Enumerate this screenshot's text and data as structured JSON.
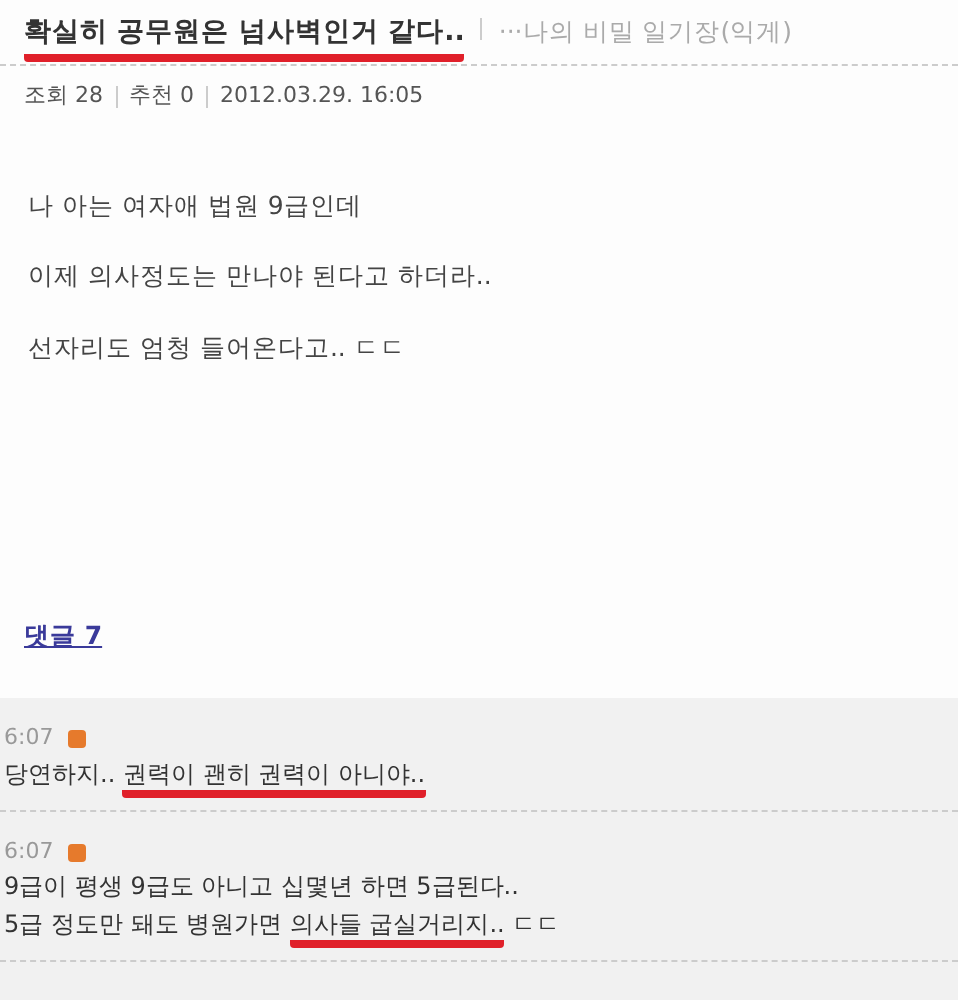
{
  "post": {
    "title": "확실히 공무원은 넘사벽인거 같다..",
    "title_highlighted": true,
    "board": "···나의 비밀 일기장(익게)",
    "views_label": "조회",
    "views": "28",
    "recommend_label": "추천",
    "recommend": "0",
    "date": "2012.03.29. 16:05",
    "paragraphs": [
      "나 아는 여자애 법원 9급인데",
      "이제 의사정도는 만나야 된다고 하더라..",
      "선자리도 엄청 들어온다고.. ㄷㄷ"
    ],
    "comments_link": "댓글 7"
  },
  "comments": [
    {
      "time": "6:07",
      "new": true,
      "lines": [
        [
          {
            "text": "당연하지.. ",
            "highlighted": false
          },
          {
            "text": "권력이 괜히 권력이 아니야..",
            "highlighted": true
          }
        ]
      ]
    },
    {
      "time": "6:07",
      "new": true,
      "lines": [
        [
          {
            "text": "9급이 평생 9급도 아니고 십몇년 하면 5급된다..",
            "highlighted": false
          }
        ],
        [
          {
            "text": "5급 정도만 돼도 병원가면 ",
            "highlighted": false
          },
          {
            "text": "의사들 굽실거리지..",
            "highlighted": true
          },
          {
            "text": " ㄷㄷ",
            "highlighted": false
          }
        ]
      ]
    }
  ]
}
